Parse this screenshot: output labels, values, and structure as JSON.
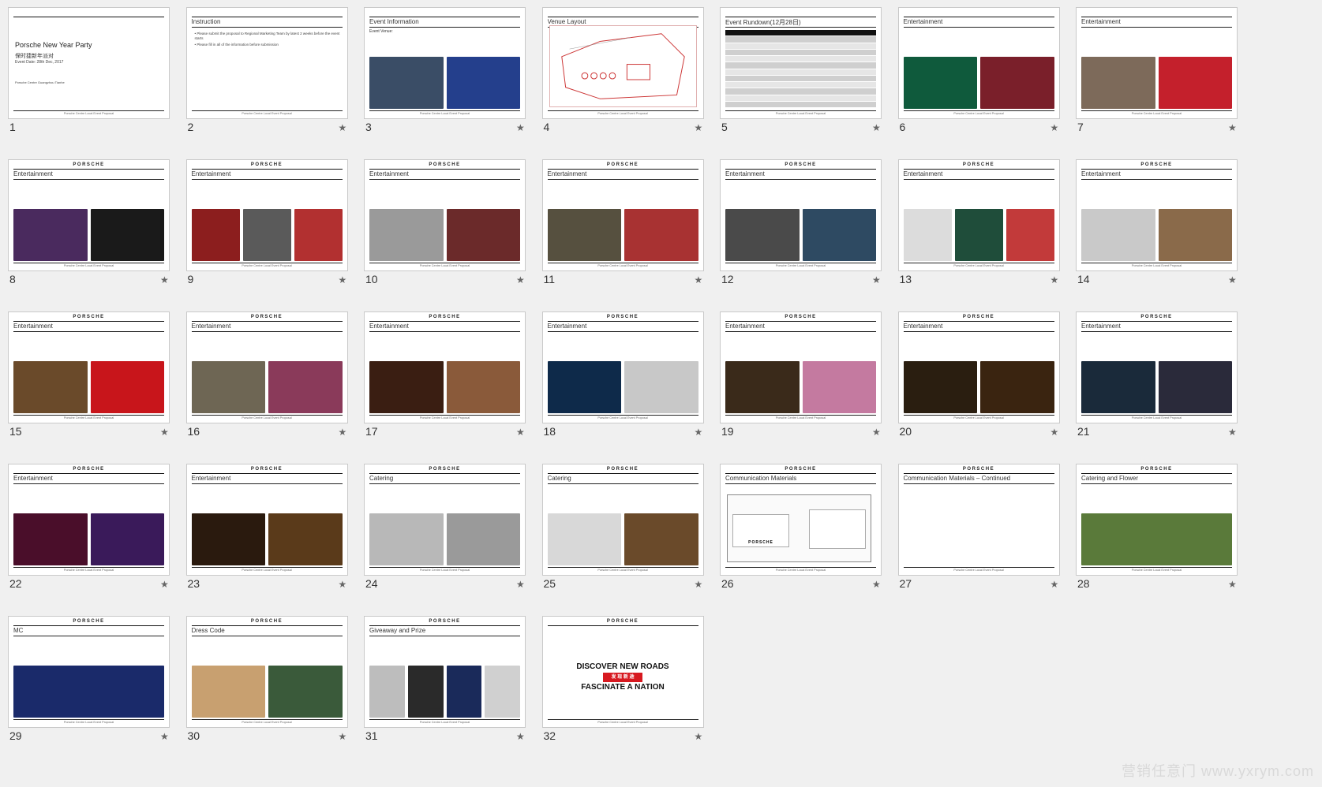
{
  "window": {
    "watermark": "营销任意门 www.yxrym.com"
  },
  "brand_logo": "PORSCHE",
  "footer_text": "Porsche Centre Local Event Proposal",
  "slides": [
    {
      "num": "1",
      "title": "",
      "lines": [
        "Porsche New Year Party",
        "保时捷新年派对",
        "Event Date: 28th Dec, 2017",
        "Porsche Centre Guangzhou Tianhe"
      ],
      "star": "",
      "type": "cover",
      "photos": []
    },
    {
      "num": "2",
      "title": "Instruction",
      "lines": [
        "Please submit the proposal to Regional Marketing Team by latest 2 weeks before the event starts",
        "Please fill in all of the information before submission"
      ],
      "star": "★",
      "type": "text",
      "photos": []
    },
    {
      "num": "3",
      "title": "Event Information",
      "lines": [
        "Event Venue:"
      ],
      "star": "★",
      "type": "photos",
      "photos": [
        "#3a4d66",
        "#243f8c"
      ]
    },
    {
      "num": "4",
      "title": "Venue Layout",
      "lines": [],
      "star": "★",
      "type": "map",
      "photos": []
    },
    {
      "num": "5",
      "title": "Event Rundown(12月28日)",
      "lines": [],
      "star": "★",
      "type": "table",
      "photos": []
    },
    {
      "num": "6",
      "title": "Entertainment",
      "lines": [],
      "star": "★",
      "type": "photos",
      "photos": [
        "#0f5a3c",
        "#7a1f2a"
      ]
    },
    {
      "num": "7",
      "title": "Entertainment",
      "lines": [],
      "star": "★",
      "type": "photos",
      "photos": [
        "#7d6a5a",
        "#c4202c"
      ]
    },
    {
      "num": "8",
      "title": "Entertainment",
      "lines": [],
      "star": "★",
      "type": "photos",
      "photos": [
        "#4a2a5e",
        "#1a1a1a"
      ]
    },
    {
      "num": "9",
      "title": "Entertainment",
      "lines": [],
      "star": "★",
      "type": "photos",
      "photos": [
        "#8c1e1e",
        "#5a5a5a",
        "#b23030"
      ]
    },
    {
      "num": "10",
      "title": "Entertainment",
      "lines": [],
      "star": "★",
      "type": "photos",
      "photos": [
        "#9a9a9a",
        "#6b2a2a"
      ]
    },
    {
      "num": "11",
      "title": "Entertainment",
      "lines": [],
      "star": "★",
      "type": "photos",
      "photos": [
        "#56503f",
        "#a83232"
      ]
    },
    {
      "num": "12",
      "title": "Entertainment",
      "lines": [],
      "star": "★",
      "type": "photos",
      "photos": [
        "#4a4a4a",
        "#2e4a62"
      ]
    },
    {
      "num": "13",
      "title": "Entertainment",
      "lines": [],
      "star": "★",
      "type": "photos",
      "photos": [
        "#dcdcdc",
        "#1f4d3a",
        "#c23a3a"
      ]
    },
    {
      "num": "14",
      "title": "Entertainment",
      "lines": [],
      "star": "★",
      "type": "photos",
      "photos": [
        "#c9c9c9",
        "#8a6a4a"
      ]
    },
    {
      "num": "15",
      "title": "Entertainment",
      "lines": [],
      "star": "★",
      "type": "photos",
      "photos": [
        "#6a4a2a",
        "#c8151b"
      ]
    },
    {
      "num": "16",
      "title": "Entertainment",
      "lines": [],
      "star": "★",
      "type": "photos",
      "photos": [
        "#6e6654",
        "#8a3a5a"
      ]
    },
    {
      "num": "17",
      "title": "Entertainment",
      "lines": [],
      "star": "★",
      "type": "photos",
      "photos": [
        "#3a1e12",
        "#8a5a3a"
      ]
    },
    {
      "num": "18",
      "title": "Entertainment",
      "lines": [],
      "star": "★",
      "type": "photos",
      "photos": [
        "#0e2a4a",
        "#c8c8c8"
      ]
    },
    {
      "num": "19",
      "title": "Entertainment",
      "lines": [],
      "star": "★",
      "type": "photos",
      "photos": [
        "#3a2a1a",
        "#c47aa0"
      ]
    },
    {
      "num": "20",
      "title": "Entertainment",
      "lines": [],
      "star": "★",
      "type": "photos",
      "photos": [
        "#2a1e10",
        "#3a2410"
      ]
    },
    {
      "num": "21",
      "title": "Entertainment",
      "lines": [],
      "star": "★",
      "type": "photos",
      "photos": [
        "#1a2a3a",
        "#2a2a3a"
      ]
    },
    {
      "num": "22",
      "title": "Entertainment",
      "lines": [],
      "star": "★",
      "type": "photos",
      "photos": [
        "#4a0e2a",
        "#3a1a5a"
      ]
    },
    {
      "num": "23",
      "title": "Entertainment",
      "lines": [],
      "star": "★",
      "type": "photos",
      "photos": [
        "#2a1a0e",
        "#5a3a1a"
      ]
    },
    {
      "num": "24",
      "title": "Catering",
      "lines": [],
      "star": "★",
      "type": "photos",
      "photos": [
        "#b8b8b8",
        "#9a9a9a"
      ]
    },
    {
      "num": "25",
      "title": "Catering",
      "lines": [],
      "star": "★",
      "type": "photos",
      "photos": [
        "#d8d8d8",
        "#6a4a2a"
      ]
    },
    {
      "num": "26",
      "title": "Communication Materials",
      "lines": [],
      "star": "★",
      "type": "doc",
      "photos": []
    },
    {
      "num": "27",
      "title": "Communication Materials – Continued",
      "lines": [],
      "star": "★",
      "type": "blank",
      "photos": []
    },
    {
      "num": "28",
      "title": "Catering and Flower",
      "lines": [],
      "star": "★",
      "type": "photos",
      "photos": [
        "#5a7a3a"
      ]
    },
    {
      "num": "29",
      "title": "MC",
      "lines": [],
      "star": "★",
      "type": "photos",
      "photos": [
        "#1a2a6a"
      ]
    },
    {
      "num": "30",
      "title": "Dress Code",
      "lines": [],
      "star": "★",
      "type": "photos",
      "photos": [
        "#c8a070",
        "#3a5a3a"
      ]
    },
    {
      "num": "31",
      "title": "Giveaway and Prize",
      "lines": [],
      "star": "★",
      "type": "photos",
      "photos": [
        "#bdbdbd",
        "#2a2a2a",
        "#1a2a5a",
        "#d0d0d0"
      ]
    },
    {
      "num": "32",
      "title": "",
      "lines": [
        "DISCOVER NEW ROADS",
        "发 现 新 途",
        "FASCINATE A NATION"
      ],
      "star": "★",
      "type": "closing",
      "photos": []
    }
  ]
}
